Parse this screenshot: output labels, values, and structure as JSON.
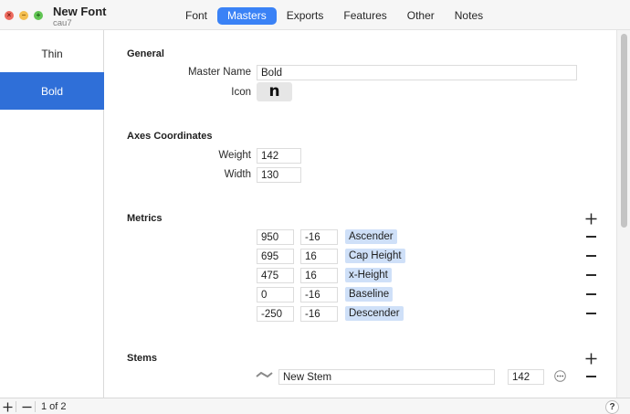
{
  "window": {
    "title": "New Font",
    "subtitle": "cau7"
  },
  "tabs": [
    {
      "label": "Font",
      "active": false
    },
    {
      "label": "Masters",
      "active": true
    },
    {
      "label": "Exports",
      "active": false
    },
    {
      "label": "Features",
      "active": false
    },
    {
      "label": "Other",
      "active": false
    },
    {
      "label": "Notes",
      "active": false
    }
  ],
  "sidebar": {
    "items": [
      {
        "label": "Thin",
        "selected": false
      },
      {
        "label": "Bold",
        "selected": true
      }
    ]
  },
  "general": {
    "heading": "General",
    "master_name_label": "Master Name",
    "master_name_value": "Bold",
    "icon_label": "Icon",
    "icon_glyph": "n"
  },
  "axes": {
    "heading": "Axes Coordinates",
    "weight_label": "Weight",
    "weight_value": "142",
    "width_label": "Width",
    "width_value": "130"
  },
  "metrics": {
    "heading": "Metrics",
    "rows": [
      {
        "position": "950",
        "overshoot": "-16",
        "name": "Ascender"
      },
      {
        "position": "695",
        "overshoot": "16",
        "name": "Cap Height"
      },
      {
        "position": "475",
        "overshoot": "16",
        "name": "x-Height"
      },
      {
        "position": "0",
        "overshoot": "-16",
        "name": "Baseline"
      },
      {
        "position": "-250",
        "overshoot": "-16",
        "name": "Descender"
      }
    ]
  },
  "stems": {
    "heading": "Stems",
    "rows": [
      {
        "name": "New Stem",
        "value": "142"
      }
    ]
  },
  "footer": {
    "page_count": "1 of 2",
    "help": "?"
  },
  "colors": {
    "accent": "#3a82f6",
    "selection": "#2f6fd8",
    "metric_tag": "#cfe0f8"
  }
}
